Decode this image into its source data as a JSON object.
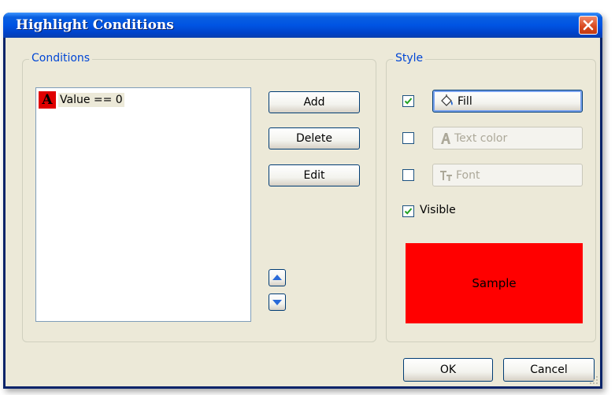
{
  "window": {
    "title": "Highlight Conditions"
  },
  "conditions": {
    "legend": "Conditions",
    "items": [
      {
        "icon": "text-color-icon",
        "icon_glyph": "A",
        "label": "Value == 0"
      }
    ],
    "add_label": "Add",
    "delete_label": "Delete",
    "edit_label": "Edit"
  },
  "style": {
    "legend": "Style",
    "fill_label": "Fill",
    "fill_checked": true,
    "text_color_label": "Text color",
    "text_color_checked": false,
    "font_label": "Font",
    "font_checked": false,
    "visible_label": "Visible",
    "visible_checked": true,
    "sample_label": "Sample",
    "sample_color": "#ff0000"
  },
  "footer": {
    "ok_label": "OK",
    "cancel_label": "Cancel"
  },
  "colors": {
    "title_bar": "#0054e3",
    "accent": "#0046d5",
    "close": "#d8481d"
  }
}
